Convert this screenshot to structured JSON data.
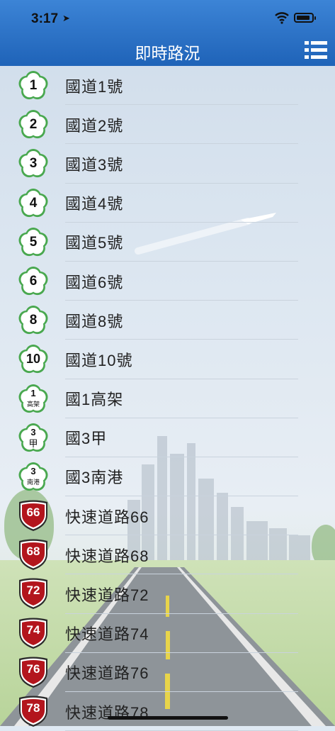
{
  "status": {
    "time": "3:17",
    "location_arrow": "location-arrow-icon"
  },
  "header": {
    "title": "即時路況",
    "menu_icon": "list-menu-icon"
  },
  "colors": {
    "nav_top": "#3c84d6",
    "nav_bottom": "#1f63b8",
    "flower_green": "#49a84f",
    "shield_red": "#b3151d"
  },
  "routes": [
    {
      "badge_type": "flower",
      "badge_main": "1",
      "badge_sub": "",
      "label": "國道1號"
    },
    {
      "badge_type": "flower",
      "badge_main": "2",
      "badge_sub": "",
      "label": "國道2號"
    },
    {
      "badge_type": "flower",
      "badge_main": "3",
      "badge_sub": "",
      "label": "國道3號"
    },
    {
      "badge_type": "flower",
      "badge_main": "4",
      "badge_sub": "",
      "label": "國道4號"
    },
    {
      "badge_type": "flower",
      "badge_main": "5",
      "badge_sub": "",
      "label": "國道5號"
    },
    {
      "badge_type": "flower",
      "badge_main": "6",
      "badge_sub": "",
      "label": "國道6號"
    },
    {
      "badge_type": "flower",
      "badge_main": "8",
      "badge_sub": "",
      "label": "國道8號"
    },
    {
      "badge_type": "flower",
      "badge_main": "10",
      "badge_sub": "",
      "label": "國道10號"
    },
    {
      "badge_type": "flower",
      "badge_main": "1",
      "badge_sub": "高架",
      "label": "國1高架"
    },
    {
      "badge_type": "flower",
      "badge_main": "3",
      "badge_sub": "甲",
      "label": "國3甲"
    },
    {
      "badge_type": "flower",
      "badge_main": "3",
      "badge_sub": "南港",
      "label": "國3南港"
    },
    {
      "badge_type": "shield",
      "badge_main": "66",
      "badge_sub": "",
      "label": "快速道路66"
    },
    {
      "badge_type": "shield",
      "badge_main": "68",
      "badge_sub": "",
      "label": "快速道路68"
    },
    {
      "badge_type": "shield",
      "badge_main": "72",
      "badge_sub": "",
      "label": "快速道路72"
    },
    {
      "badge_type": "shield",
      "badge_main": "74",
      "badge_sub": "",
      "label": "快速道路74"
    },
    {
      "badge_type": "shield",
      "badge_main": "76",
      "badge_sub": "",
      "label": "快速道路76"
    },
    {
      "badge_type": "shield",
      "badge_main": "78",
      "badge_sub": "",
      "label": "快速道路78"
    }
  ]
}
